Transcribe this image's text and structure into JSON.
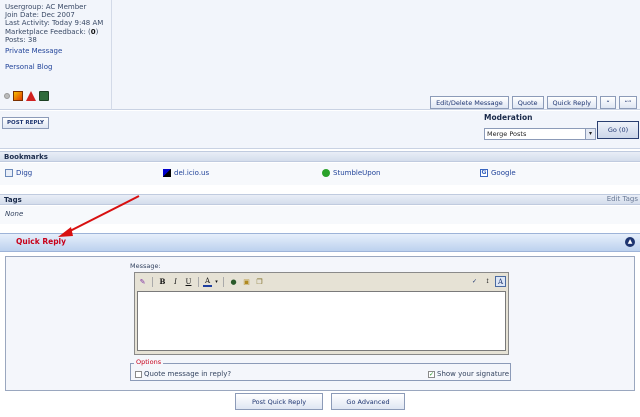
{
  "user": {
    "usergroup": "Usergroup: AC Member",
    "join_date": "Join Date: Dec 2007",
    "last_activity": "Last Activity: Today 9:48 AM",
    "feedback_label": "Marketplace Feedback: (",
    "feedback_value": "0",
    "feedback_close": ")",
    "posts": "Posts: 38",
    "private_message": "Private Message",
    "personal_blog": "Personal Blog"
  },
  "post_buttons": {
    "edit_delete": "Edit/Delete Message",
    "quote": "Quote",
    "quick_reply": "Quick Reply",
    "multi_quote": "“",
    "quote_small": "“”"
  },
  "reply": {
    "post_reply": "POST REPLY"
  },
  "moderation": {
    "label": "Moderation",
    "selected": "Merge Posts",
    "go": "Go (0)"
  },
  "bookmarks": {
    "title": "Bookmarks",
    "items": [
      "Digg",
      "del.icio.us",
      "StumbleUpon",
      "Google"
    ]
  },
  "tags": {
    "title": "Tags",
    "edit": "Edit Tags",
    "none": "None"
  },
  "quick_reply": {
    "title": "Quick Reply",
    "collapse_icon": "▲",
    "message_label": "Message:",
    "options_legend": "Options",
    "quote_message": "Quote message in reply?",
    "show_signature": "Show your signature",
    "post_button": "Post Quick Reply",
    "advanced_button": "Go Advanced"
  },
  "toolbar": {
    "bold": "B",
    "italic": "I",
    "underline": "U",
    "font_color": "A"
  },
  "colors": {
    "accent_red": "#c8001a",
    "link_blue": "#22449a",
    "header_blue": "#bcd1ee"
  }
}
